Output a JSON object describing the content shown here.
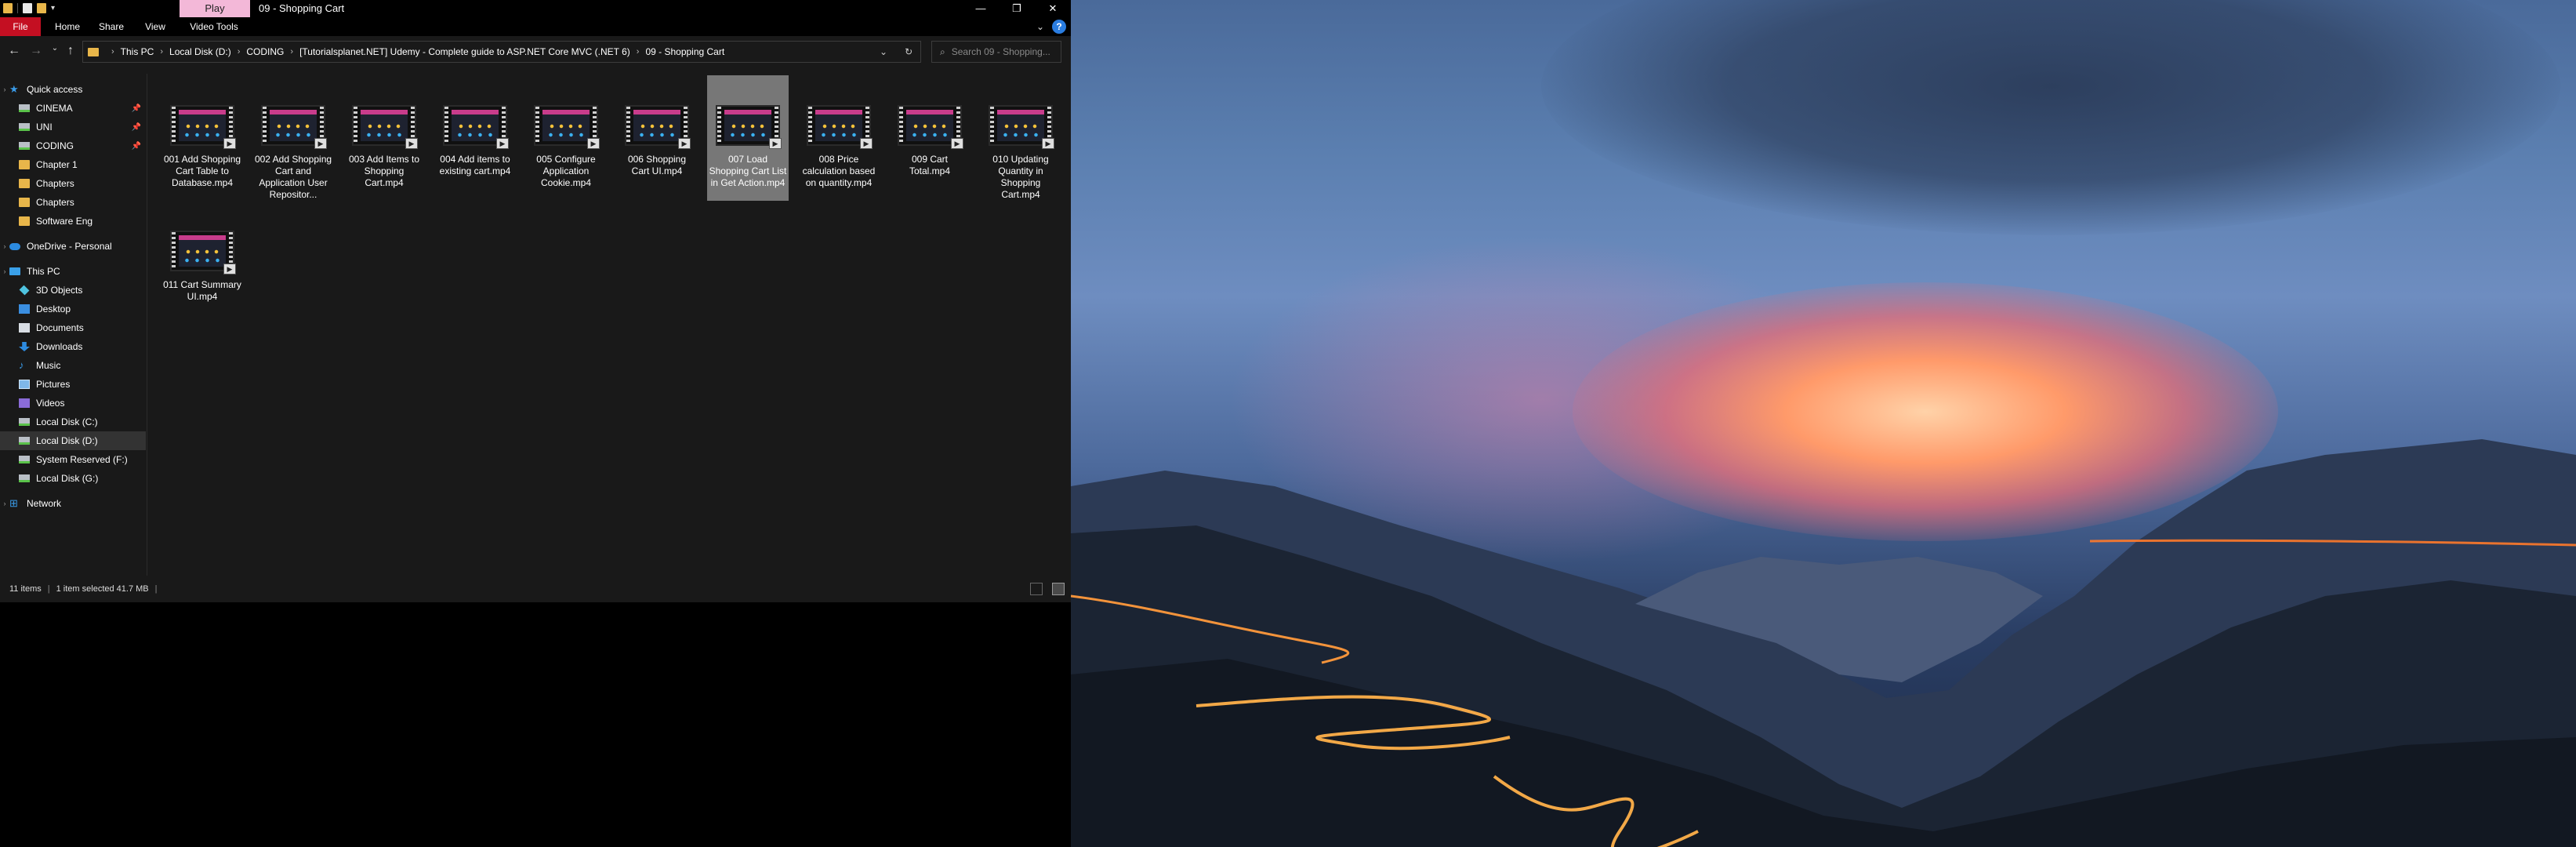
{
  "window": {
    "title": "09 - Shopping Cart",
    "context_tab": "Play",
    "controls": {
      "minimize": "—",
      "maximize": "❐",
      "close": "✕"
    }
  },
  "ribbon": {
    "tabs": [
      "File",
      "Home",
      "Share",
      "View",
      "Video Tools"
    ],
    "help": "?"
  },
  "address": {
    "crumbs": [
      "This PC",
      "Local Disk (D:)",
      "CODING",
      "[Tutorialsplanet.NET] Udemy - Complete guide to ASP.NET Core MVC (.NET 6)",
      "09 - Shopping Cart"
    ],
    "search_placeholder": "Search 09 - Shopping..."
  },
  "nav": {
    "items": [
      {
        "label": "Quick access",
        "icon": "star-icon",
        "pinned": false
      },
      {
        "label": "CINEMA",
        "icon": "drive-icon",
        "pinned": true
      },
      {
        "label": "UNI",
        "icon": "drive-icon",
        "pinned": true
      },
      {
        "label": "CODING",
        "icon": "drive-icon",
        "pinned": true
      },
      {
        "label": "Chapter 1",
        "icon": "folder-icon",
        "pinned": false
      },
      {
        "label": "Chapters",
        "icon": "folder-icon",
        "pinned": false
      },
      {
        "label": "Chapters",
        "icon": "folder-icon",
        "pinned": false
      },
      {
        "label": "Software Eng",
        "icon": "folder-icon",
        "pinned": false
      },
      {
        "label": "OneDrive - Personal",
        "icon": "cloud-icon",
        "pinned": false
      },
      {
        "label": "This PC",
        "icon": "computer-icon",
        "pinned": false
      },
      {
        "label": "3D Objects",
        "icon": "cube-icon",
        "pinned": false
      },
      {
        "label": "Desktop",
        "icon": "desktop-icon",
        "pinned": false
      },
      {
        "label": "Documents",
        "icon": "documents-icon",
        "pinned": false
      },
      {
        "label": "Downloads",
        "icon": "download-icon",
        "pinned": false
      },
      {
        "label": "Music",
        "icon": "music-icon",
        "pinned": false
      },
      {
        "label": "Pictures",
        "icon": "pictures-icon",
        "pinned": false
      },
      {
        "label": "Videos",
        "icon": "video-icon",
        "pinned": false
      },
      {
        "label": "Local Disk (C:)",
        "icon": "drive-icon",
        "pinned": false
      },
      {
        "label": "Local Disk (D:)",
        "icon": "drive-icon",
        "pinned": false
      },
      {
        "label": "System Reserved (F:)",
        "icon": "drive-icon",
        "pinned": false
      },
      {
        "label": "Local Disk (G:)",
        "icon": "drive-icon",
        "pinned": false
      },
      {
        "label": "Network",
        "icon": "network-icon",
        "pinned": false
      }
    ]
  },
  "files": [
    {
      "name": "001 Add Shopping Cart Table to Database.mp4"
    },
    {
      "name": "002 Add Shopping Cart and Application User Repositor..."
    },
    {
      "name": "003 Add Items to Shopping Cart.mp4"
    },
    {
      "name": "004 Add items to existing cart.mp4"
    },
    {
      "name": "005 Configure Application Cookie.mp4"
    },
    {
      "name": "006 Shopping Cart UI.mp4"
    },
    {
      "name": "007 Load Shopping Cart List in Get Action.mp4"
    },
    {
      "name": "008 Price calculation based on quantity.mp4"
    },
    {
      "name": "009 Cart Total.mp4"
    },
    {
      "name": "010 Updating Quantity in Shopping Cart.mp4"
    },
    {
      "name": "011 Cart Summary UI.mp4"
    }
  ],
  "status": {
    "count": "11 items",
    "selection": "1 item selected  41.7 MB"
  },
  "colors": {
    "file_tab": "#c40f22",
    "play_tab": "#f3b8d8",
    "accent": "#3a9be8"
  }
}
